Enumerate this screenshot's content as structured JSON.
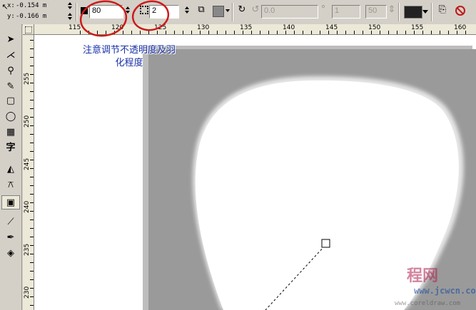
{
  "property_bar": {
    "x_coord": "-0.154 m",
    "y_coord": "-0.166 m",
    "opacity_value": "80",
    "feather_value": "2",
    "angle_value": "0.0",
    "steps_value": "1",
    "step_size_value": "50"
  },
  "ruler": {
    "h_labels": [
      "115",
      "120",
      "125",
      "130",
      "135",
      "140",
      "145",
      "150",
      "155",
      "160"
    ],
    "v_labels": [
      "255",
      "250",
      "245",
      "240",
      "235",
      "230"
    ]
  },
  "annotation": {
    "line1": "注意调节不透明度及羽",
    "line2": "化程度"
  },
  "watermark": {
    "brand": "程网",
    "url": "www.jcwcn.com",
    "sub": "www.coreldraw.com"
  },
  "colors": {
    "annotation_circle": "#cc1a1a",
    "annotation_text": "#1830a8",
    "shadow_gray": "#8a8a8a",
    "toolbar_bg": "#d4d0c8"
  },
  "icons": {
    "tools": [
      "pick-tool-icon",
      "shape-tool-icon",
      "zoom-tool-icon",
      "freehand-tool-icon",
      "rectangle-tool-icon",
      "ellipse-tool-icon",
      "graph-paper-tool-icon",
      "text-tool-icon",
      "interactive-fill-icon",
      "blend-tool-icon",
      "shadow-tool-icon",
      "eyedropper-tool-icon",
      "outline-tool-icon",
      "fill-tool-icon"
    ]
  }
}
